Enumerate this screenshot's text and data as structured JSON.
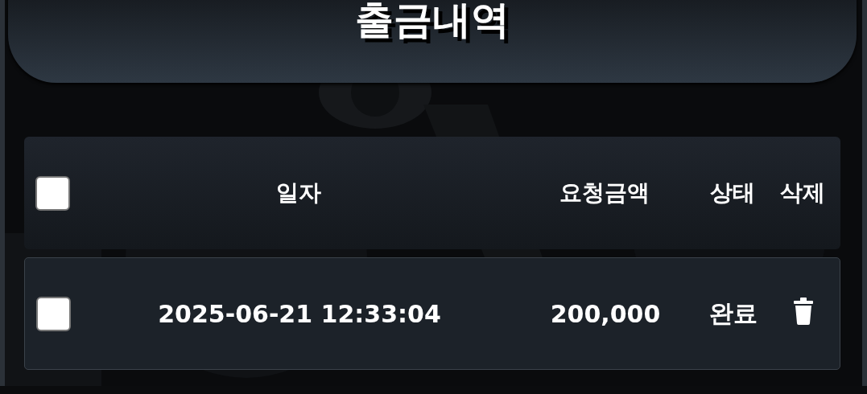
{
  "title": "출금내역",
  "table": {
    "select_all": {
      "checked": false
    },
    "columns": [
      "일자",
      "요청금액",
      "상태",
      "삭제"
    ],
    "rows": [
      {
        "checked": false,
        "date": "2025-06-21 12:33:04",
        "amount": "200,000",
        "status": "완료"
      }
    ]
  }
}
